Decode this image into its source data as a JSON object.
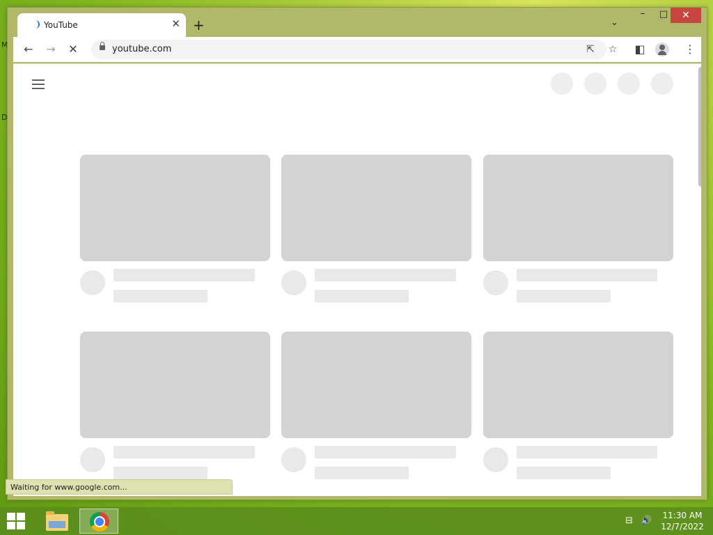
{
  "desktop": {
    "edge_labels": [
      "M",
      "D"
    ]
  },
  "browser": {
    "tab": {
      "title": "YouTube",
      "close_glyph": "✕"
    },
    "new_tab_glyph": "+",
    "tab_search_glyph": "⌄",
    "window_controls": {
      "minimize": "–",
      "maximize": "□",
      "close": "✕"
    },
    "nav": {
      "back": "←",
      "forward": "→",
      "stop": "✕"
    },
    "address_bar": {
      "url": "youtube.com"
    },
    "omnibox_icons": {
      "share": "⇱",
      "bookmark": "☆"
    },
    "side_panel_glyph": "◧",
    "menu_glyph": "⋮",
    "status_text": "Waiting for www.google.com..."
  },
  "taskbar": {
    "apps": [
      {
        "name": "File Explorer",
        "icon": "folder-icon"
      },
      {
        "name": "Google Chrome",
        "icon": "chrome-icon",
        "active": true
      }
    ],
    "tray": {
      "network": "⊟",
      "volume": "🔊"
    },
    "clock": {
      "time": "11:30 AM",
      "date": "12/7/2022"
    }
  },
  "colors": {
    "accent": "#1a73e8",
    "close_red": "#c7463e",
    "skeleton": "#d3d3d3"
  }
}
